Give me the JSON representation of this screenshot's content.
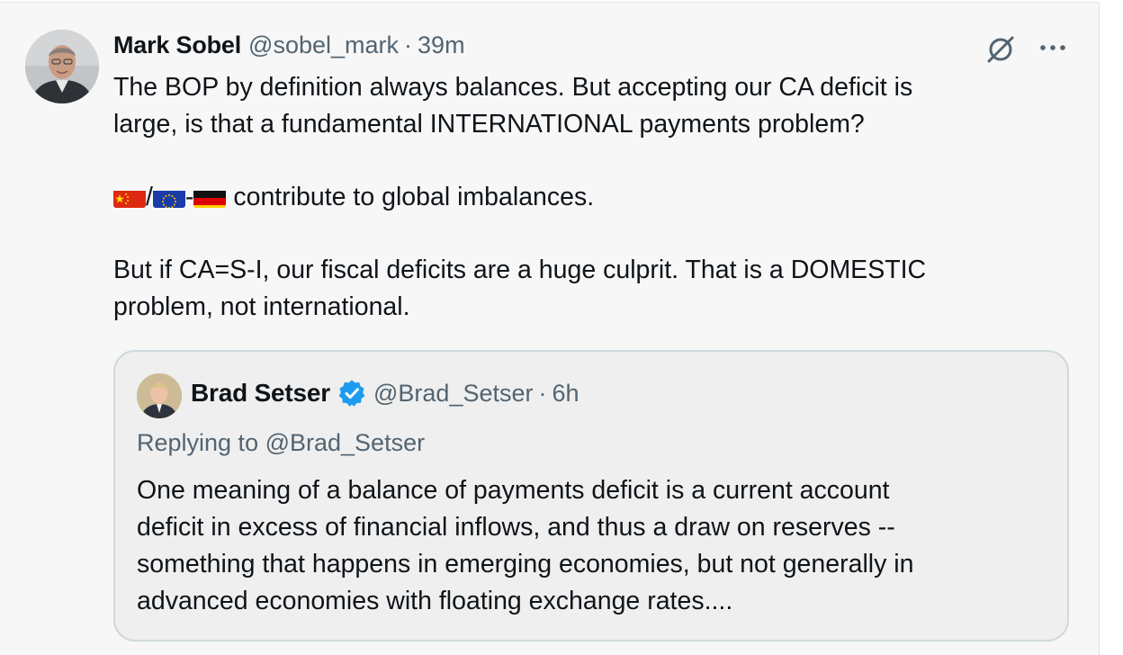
{
  "tweet": {
    "author_name": "Mark Sobel",
    "author_handle": "@sobel_mark",
    "separator": "·",
    "time": "39m",
    "icons": {
      "grok": "slashed-circle-icon",
      "more": "more-dots-icon"
    },
    "text": {
      "line1": "The BOP by definition always balances. But accepting our CA deficit is",
      "line2": "large, is that a fundamental INTERNATIONAL payments problem?",
      "flag_slash": "/",
      "flag_dash": "-",
      "line3_rest": " contribute to global imbalances.",
      "line4": "But if CA=S-I, our fiscal deficits are a huge culprit. That is a DOMESTIC",
      "line5": "problem, not international."
    }
  },
  "quoted_tweet": {
    "author_name": "Brad Setser",
    "author_handle": "@Brad_Setser",
    "separator": "·",
    "time": "6h",
    "verified_badge": "verified-badge-icon",
    "replying_to": "Replying to @Brad_Setser",
    "text_lines": [
      "One meaning of a balance of payments deficit is a current account",
      "deficit in excess of financial inflows, and thus a draw on reserves --",
      "something that happens in emerging economies, but not generally in",
      "advanced economies with floating exchange rates...."
    ]
  },
  "colors": {
    "background": "#f7f7f7",
    "text_primary": "#0f1419",
    "text_secondary": "#536471",
    "verified_blue": "#1d9bf0",
    "quote_border": "#cfd9de"
  }
}
